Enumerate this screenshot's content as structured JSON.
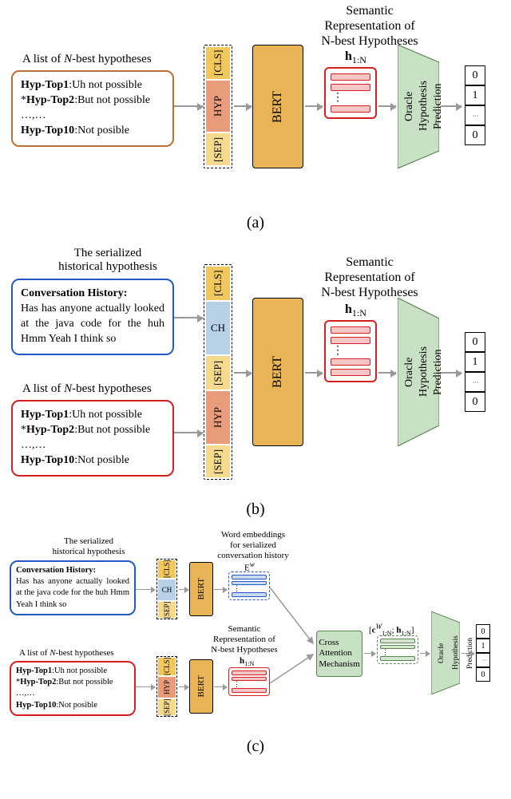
{
  "labels": {
    "nbest_title": "A list of N-best hypotheses",
    "hist_title": "The serialized\nhistorical hypothesis",
    "semrep_title": "Semantic\nRepresentation of\nN-best Hypotheses",
    "wordemb_title": "Word embeddings\nfor serialized\nconversation history",
    "h1n": "h",
    "h1n_sub": "1:N",
    "Ew": "E",
    "Ew_sup": "w",
    "cw_h": "[c",
    "cw_h_rest": "; h",
    "cw_h_end": "]",
    "cw_sup": "W",
    "cw_sub": "1:N",
    "cross_attn": "Cross\nAttention\nMechanism",
    "oracle": "Oracle\nHypothesis\nPrediction",
    "bert": "BERT",
    "conv_hist_label": "Conversation History",
    "conv_hist_text": "Has has anyone actually looked at the java code for the huh Hmm Yeah I think so",
    "hyp1_label": "Hyp-Top1",
    "hyp1_text": ":Uh not possible",
    "hyp2_label": "Hyp-Top2",
    "hyp2_text": ":But not possible",
    "hyp_dots": "…,…",
    "hyp10_label": "Hyp-Top10",
    "hyp10_text": ":Not posible"
  },
  "tokens": {
    "cls": "[CLS]",
    "sep": "[SEP]",
    "hyp": "HYP",
    "ch": "CH"
  },
  "outputs": [
    "0",
    "1",
    "⋮",
    "0"
  ],
  "captions": {
    "a": "(a)",
    "b": "(b)",
    "c": "(c)"
  },
  "chart_data": {
    "type": "diagram",
    "subfigures": [
      {
        "id": "a",
        "description": "BERT-based oracle hypothesis prediction from N-best list only",
        "input_blocks": [
          {
            "name": "N-best hypotheses"
          }
        ],
        "token_sequence": [
          "[CLS]",
          "HYP",
          "[SEP]"
        ],
        "encoder": "BERT",
        "intermediate": [
          "Semantic Representation of N-best Hypotheses h_{1:N}"
        ],
        "head": "Oracle Hypothesis Prediction",
        "output_vector": [
          0,
          1,
          "...",
          0
        ]
      },
      {
        "id": "b",
        "description": "BERT with concatenated conversation history + N-best list",
        "input_blocks": [
          {
            "name": "Serialized historical hypothesis"
          },
          {
            "name": "N-best hypotheses"
          }
        ],
        "token_sequence": [
          "[CLS]",
          "CH",
          "[SEP]",
          "HYP",
          "[SEP]"
        ],
        "encoder": "BERT",
        "intermediate": [
          "Semantic Representation of N-best Hypotheses h_{1:N}"
        ],
        "head": "Oracle Hypothesis Prediction",
        "output_vector": [
          0,
          1,
          "...",
          0
        ]
      },
      {
        "id": "c",
        "description": "Two-stream BERT encoders with cross-attention fusion",
        "input_blocks": [
          {
            "name": "Serialized historical hypothesis"
          },
          {
            "name": "N-best hypotheses"
          }
        ],
        "upper_tokens": [
          "[CLS]",
          "CH",
          "[SEP]"
        ],
        "lower_tokens": [
          "[CLS]",
          "HYP",
          "[SEP]"
        ],
        "encoder": "BERT (x2)",
        "intermediate": [
          "Word embeddings E^w",
          "h_{1:N}"
        ],
        "fusion": "Cross Attention Mechanism",
        "fused_repr": "[c^W_{1:N}; h_{1:N}]",
        "head": "Oracle Hypothesis Prediction",
        "output_vector": [
          0,
          1,
          "...",
          0
        ]
      }
    ]
  }
}
